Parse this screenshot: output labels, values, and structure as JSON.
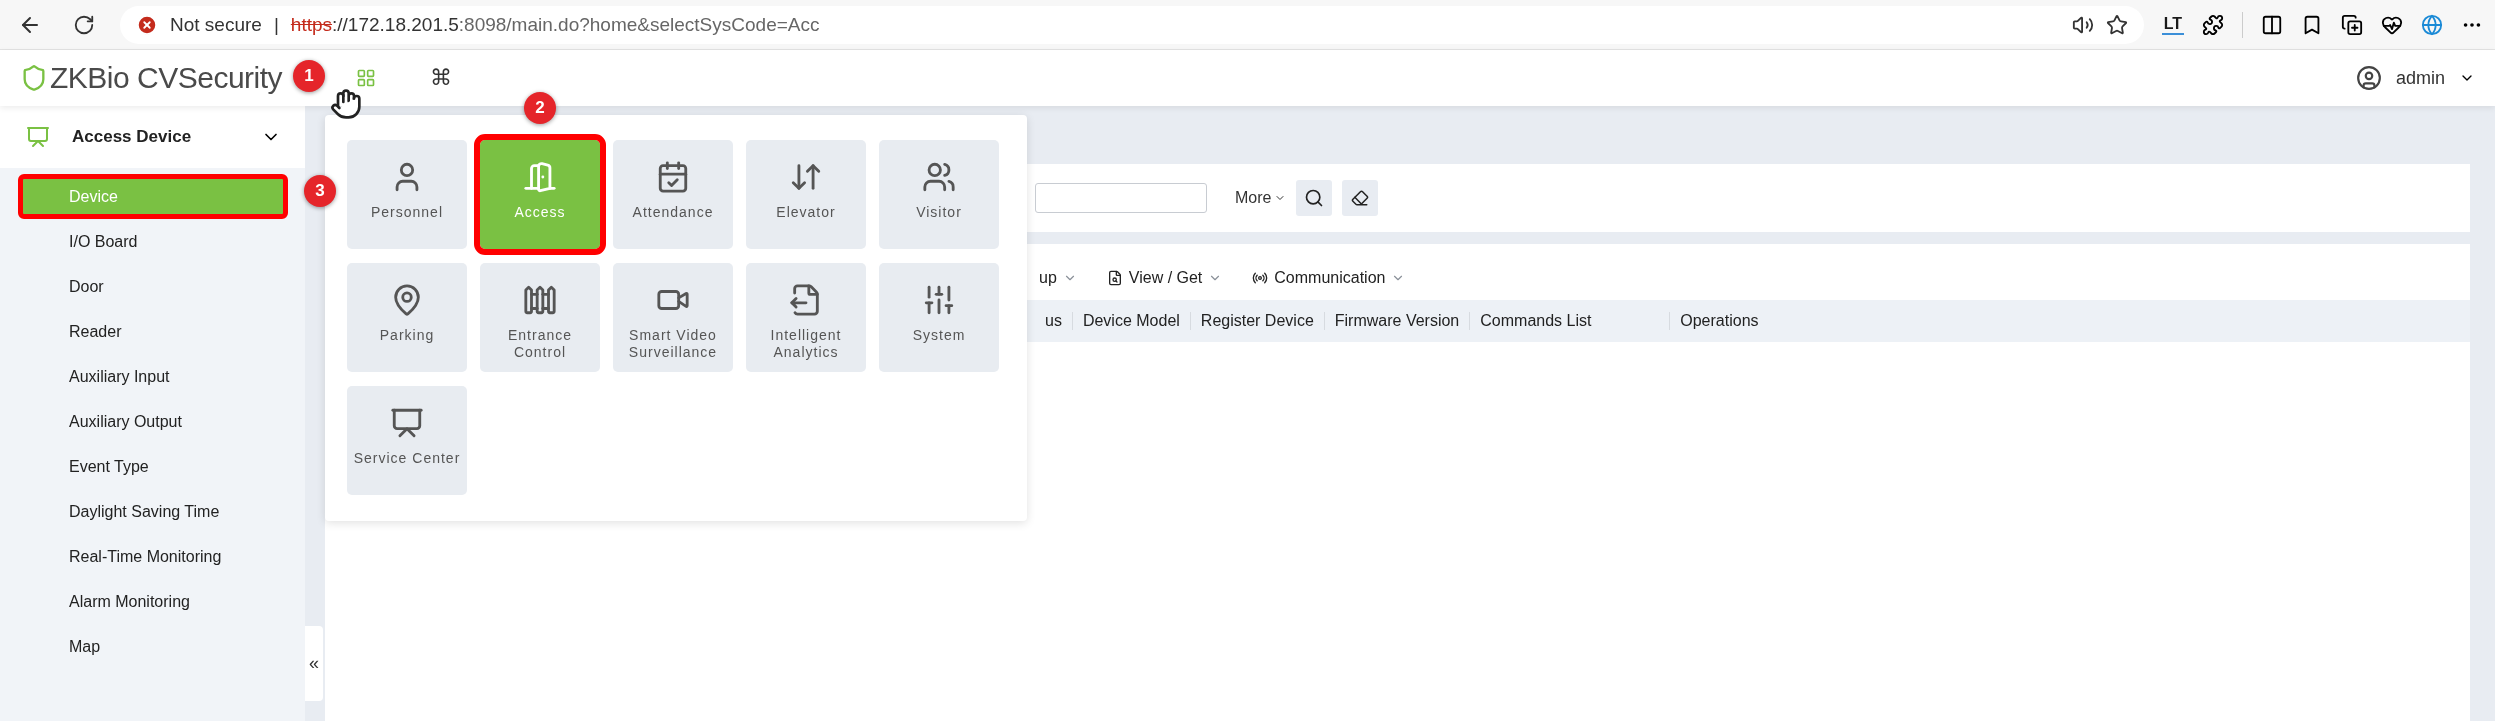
{
  "browser": {
    "security_label": "Not secure",
    "separator": "|",
    "url": {
      "scheme": "https",
      "host": "://172.18.201.5",
      "path": ":8098/main.do?home&selectSysCode=Acc"
    },
    "extension_label": "LT"
  },
  "header": {
    "logo": "ZKBio CVSecurity",
    "shortcut": "⌘",
    "user": "admin"
  },
  "sidebar": {
    "section": "Access Device",
    "expanded": true,
    "items": [
      {
        "label": "Device",
        "selected": true,
        "annotated": true
      },
      {
        "label": "I/O Board",
        "selected": false,
        "annotated": false
      },
      {
        "label": "Door",
        "selected": false,
        "annotated": false
      },
      {
        "label": "Reader",
        "selected": false,
        "annotated": false
      },
      {
        "label": "Auxiliary Input",
        "selected": false,
        "annotated": false
      },
      {
        "label": "Auxiliary Output",
        "selected": false,
        "annotated": false
      },
      {
        "label": "Event Type",
        "selected": false,
        "annotated": false
      },
      {
        "label": "Daylight Saving Time",
        "selected": false,
        "annotated": false
      },
      {
        "label": "Real-Time Monitoring",
        "selected": false,
        "annotated": false
      },
      {
        "label": "Alarm Monitoring",
        "selected": false,
        "annotated": false
      },
      {
        "label": "Map",
        "selected": false,
        "annotated": false
      }
    ],
    "collapse": "«"
  },
  "search": {
    "more": "More"
  },
  "toolbar": [
    "up",
    "View / Get",
    "Communication"
  ],
  "table": {
    "columns": [
      "us",
      "Device Model",
      "Register Device",
      "Firmware Version",
      "Commands List",
      "Operations"
    ]
  },
  "module_menu": {
    "tiles": [
      {
        "label": "Personnel",
        "selected": false,
        "annotated": false
      },
      {
        "label": "Access",
        "selected": true,
        "annotated": true
      },
      {
        "label": "Attendance",
        "selected": false,
        "annotated": false
      },
      {
        "label": "Elevator",
        "selected": false,
        "annotated": false
      },
      {
        "label": "Visitor",
        "selected": false,
        "annotated": false
      },
      {
        "label": "Parking",
        "selected": false,
        "annotated": false
      },
      {
        "label": "Entrance Control",
        "selected": false,
        "annotated": false
      },
      {
        "label": "Smart Video Surveillance",
        "selected": false,
        "annotated": false
      },
      {
        "label": "Intelligent Analytics",
        "selected": false,
        "annotated": false
      },
      {
        "label": "System",
        "selected": false,
        "annotated": false
      },
      {
        "label": "Service Center",
        "selected": false,
        "annotated": false
      }
    ]
  },
  "step_badges": [
    "1",
    "2",
    "3"
  ]
}
